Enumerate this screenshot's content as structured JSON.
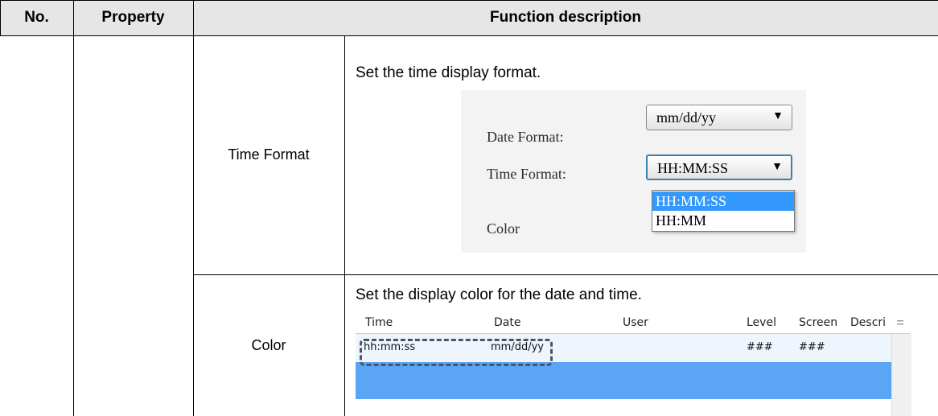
{
  "table": {
    "headers": {
      "no": "No.",
      "property": "Property",
      "description": "Function description"
    },
    "rows": [
      {
        "sub_property": "Time Format",
        "description": "Set the time display format.",
        "panel": {
          "date_label": "Date Format:",
          "date_value": "mm/dd/yy",
          "time_label": "Time Format:",
          "time_value": "HH:MM:SS",
          "options": [
            "HH:MM:SS",
            "HH:MM"
          ],
          "color_label": "Color",
          "dropdown_arrow": "▼"
        }
      },
      {
        "sub_property": "Color",
        "description": "Set the display color for the date and time.",
        "alarm_list": {
          "columns": [
            "Time",
            "Date",
            "User",
            "Level",
            "Screen",
            "Descri"
          ],
          "row": {
            "time": "hh:mm:ss",
            "date": "mm/dd/yy",
            "level": "###",
            "screen": "###"
          }
        }
      }
    ]
  },
  "colors": {
    "header_bg": "#e6e6e6",
    "selection_blue": "#3399ff",
    "selected_row_blue": "#5aa6f5",
    "focus_border": "#3c7fb1"
  },
  "icons": {
    "dropdown": "chevron-down-icon",
    "scrollbar_grip": "scroll-grip-icon"
  }
}
